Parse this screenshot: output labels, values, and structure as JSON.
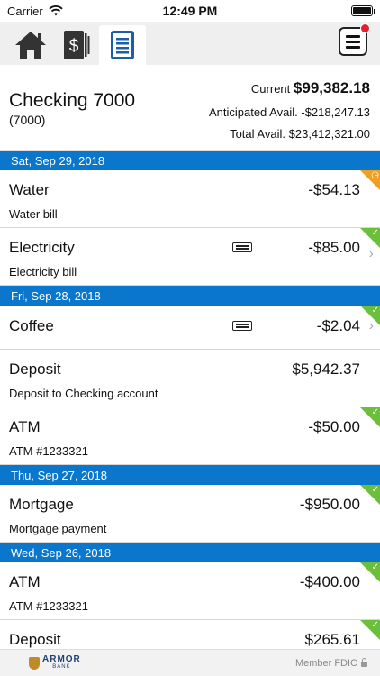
{
  "status_bar": {
    "carrier": "Carrier",
    "time": "12:49 PM"
  },
  "nav": {
    "tabs": [
      {
        "icon": "home-icon"
      },
      {
        "icon": "money-icon"
      },
      {
        "icon": "register-icon",
        "active": true
      }
    ],
    "menu_icon": "menu-icon"
  },
  "account": {
    "name": "Checking 7000",
    "number": "(7000)",
    "current_label": "Current",
    "current_amount": "$99,382.18",
    "anticipated_label": "Anticipated Avail.",
    "anticipated_amount": "-$218,247.13",
    "total_label": "Total Avail.",
    "total_amount": "$23,412,321.00"
  },
  "groups": [
    {
      "date": "Sat, Sep 29, 2018",
      "transactions": [
        {
          "title": "Water",
          "amount": "-$54.13",
          "subtitle": "Water bill",
          "status": "pending"
        },
        {
          "title": "Electricity",
          "amount": "-$85.00",
          "subtitle": "Electricity bill",
          "status": "cleared",
          "has_note": true,
          "has_chevron": true
        }
      ]
    },
    {
      "date": "Fri, Sep 28, 2018",
      "transactions": [
        {
          "title": "Coffee",
          "amount": "-$2.04",
          "subtitle": "",
          "status": "cleared",
          "has_note": true,
          "has_chevron": true
        },
        {
          "title": "Deposit",
          "amount": "$5,942.37",
          "subtitle": "Deposit to Checking account",
          "status": "none"
        },
        {
          "title": "ATM",
          "amount": "-$50.00",
          "subtitle": "ATM #1233321",
          "status": "cleared"
        }
      ]
    },
    {
      "date": "Thu, Sep 27, 2018",
      "transactions": [
        {
          "title": "Mortgage",
          "amount": "-$950.00",
          "subtitle": "Mortgage payment",
          "status": "cleared"
        }
      ]
    },
    {
      "date": "Wed, Sep 26, 2018",
      "transactions": [
        {
          "title": "ATM",
          "amount": "-$400.00",
          "subtitle": "ATM #1233321",
          "status": "cleared"
        },
        {
          "title": "Deposit",
          "amount": "$265.61",
          "subtitle": "",
          "status": "cleared"
        }
      ]
    }
  ],
  "footer": {
    "bank_name": "ARMOR",
    "bank_sub": "BANK",
    "member_fdic": "Member FDIC"
  },
  "colors": {
    "date_header": "#0a77cc",
    "cleared": "#6bbf3a",
    "pending": "#f0a020",
    "alert": "#e8202a"
  }
}
